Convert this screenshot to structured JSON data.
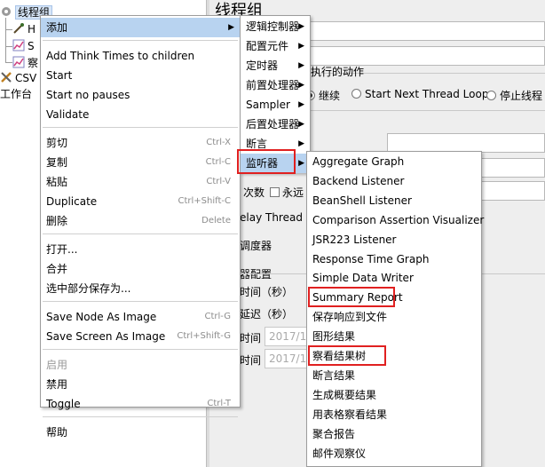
{
  "tree": {
    "root": "线程组",
    "child1": "H",
    "child2": "S",
    "child3": "察",
    "csv": "CSV",
    "workbench": "工作台"
  },
  "panel": {
    "title": "线程组",
    "action_label": "执行的动作",
    "radio_continue": "继续",
    "radio_next_loop": "Start Next Thread Loop",
    "radio_stop": "停止线程",
    "loop_label": "次数",
    "forever": "永远",
    "delay_thread": "elay Thread c",
    "scheduler": "调度器",
    "scheduler_config": "器配置",
    "duration": "时间（秒）",
    "startup_delay": "延迟（秒）",
    "start_time_label": "时间",
    "start_time_value": "2017/10",
    "end_time_label": "时间",
    "end_time_value": "2017/10"
  },
  "context_menu": [
    {
      "label": "添加",
      "submenu": true,
      "highlight": true
    },
    {
      "sep": true
    },
    {
      "label": "Add Think Times to children"
    },
    {
      "label": "Start"
    },
    {
      "label": "Start no pauses"
    },
    {
      "label": "Validate"
    },
    {
      "sep": true
    },
    {
      "label": "剪切",
      "shortcut": "Ctrl-X"
    },
    {
      "label": "复制",
      "shortcut": "Ctrl-C"
    },
    {
      "label": "粘贴",
      "shortcut": "Ctrl-V"
    },
    {
      "label": "Duplicate",
      "shortcut": "Ctrl+Shift-C"
    },
    {
      "label": "删除",
      "shortcut": "Delete"
    },
    {
      "sep": true
    },
    {
      "label": "打开..."
    },
    {
      "label": "合并"
    },
    {
      "label": "选中部分保存为..."
    },
    {
      "sep": true
    },
    {
      "label": "Save Node As Image",
      "shortcut": "Ctrl-G"
    },
    {
      "label": "Save Screen As Image",
      "shortcut": "Ctrl+Shift-G"
    },
    {
      "sep": true
    },
    {
      "label": "启用",
      "disabled": true
    },
    {
      "label": "禁用"
    },
    {
      "label": "Toggle",
      "shortcut": "Ctrl-T"
    },
    {
      "sep": true
    },
    {
      "label": "帮助"
    }
  ],
  "add_submenu": [
    {
      "label": "逻辑控制器",
      "submenu": true
    },
    {
      "label": "配置元件",
      "submenu": true
    },
    {
      "label": "定时器",
      "submenu": true
    },
    {
      "label": "前置处理器",
      "submenu": true
    },
    {
      "label": "Sampler",
      "submenu": true
    },
    {
      "label": "后置处理器",
      "submenu": true
    },
    {
      "label": "断言",
      "submenu": true
    },
    {
      "label": "监听器",
      "submenu": true,
      "highlight": true,
      "boxed": true
    }
  ],
  "listener_submenu": [
    {
      "label": "Aggregate Graph"
    },
    {
      "label": "Backend Listener"
    },
    {
      "label": "BeanShell Listener"
    },
    {
      "label": "Comparison Assertion Visualizer"
    },
    {
      "label": "JSR223 Listener"
    },
    {
      "label": "Response Time Graph"
    },
    {
      "label": "Simple Data Writer"
    },
    {
      "label": "Summary Report",
      "boxed": true
    },
    {
      "label": "保存响应到文件"
    },
    {
      "label": "图形结果"
    },
    {
      "label": "察看结果树",
      "boxed": true
    },
    {
      "label": "断言结果"
    },
    {
      "label": "生成概要结果"
    },
    {
      "label": "用表格察看结果"
    },
    {
      "label": "聚合报告"
    },
    {
      "label": "邮件观察仪"
    }
  ],
  "colors": {
    "highlight": "#b8d3f0",
    "annotation_box": "#e02020",
    "shortcut_text": "#8c8c8c"
  }
}
